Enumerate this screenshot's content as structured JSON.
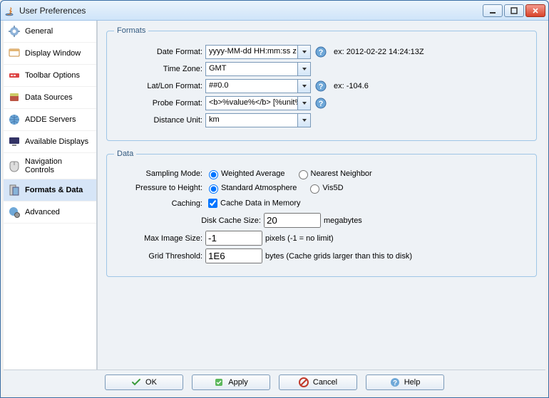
{
  "window": {
    "title": "User Preferences"
  },
  "sidebar": {
    "items": [
      {
        "label": "General",
        "icon": "gear-icon",
        "selected": false
      },
      {
        "label": "Display Window",
        "icon": "monitor-icon",
        "selected": false
      },
      {
        "label": "Toolbar Options",
        "icon": "toolbar-icon",
        "selected": false
      },
      {
        "label": "Data Sources",
        "icon": "datasources-icon",
        "selected": false
      },
      {
        "label": "ADDE Servers",
        "icon": "globe-icon",
        "selected": false
      },
      {
        "label": "Available Displays",
        "icon": "display-icon",
        "selected": false
      },
      {
        "label": "Navigation Controls",
        "icon": "mouse-icon",
        "selected": false
      },
      {
        "label": "Formats & Data",
        "icon": "formats-icon",
        "selected": true
      },
      {
        "label": "Advanced",
        "icon": "globe-gear-icon",
        "selected": false
      }
    ]
  },
  "formats": {
    "legend": "Formats",
    "date_format": {
      "label": "Date Format:",
      "value": "yyyy-MM-dd HH:mm:ss z",
      "hint": "ex:  2012-02-22 14:24:13Z"
    },
    "time_zone": {
      "label": "Time Zone:",
      "value": "GMT"
    },
    "latlon_format": {
      "label": "Lat/Lon Format:",
      "value": "##0.0",
      "hint": "ex: -104.6"
    },
    "probe_format": {
      "label": "Probe Format:",
      "value": "<b>%value%</b> [%unit%]"
    },
    "distance_unit": {
      "label": "Distance Unit:",
      "value": "km"
    }
  },
  "data": {
    "legend": "Data",
    "sampling_mode": {
      "label": "Sampling Mode:",
      "options": [
        {
          "label": "Weighted Average",
          "checked": true
        },
        {
          "label": "Nearest Neighbor",
          "checked": false
        }
      ]
    },
    "pressure_to_height": {
      "label": "Pressure to Height:",
      "options": [
        {
          "label": "Standard Atmosphere",
          "checked": true
        },
        {
          "label": "Vis5D",
          "checked": false
        }
      ]
    },
    "caching": {
      "label": "Caching:",
      "checkbox_label": "Cache Data in Memory",
      "checked": true
    },
    "disk_cache": {
      "label": "Disk Cache Size:",
      "value": "20",
      "suffix": "megabytes"
    },
    "max_image": {
      "label": "Max Image Size:",
      "value": "-1",
      "suffix": "pixels (-1 = no limit)"
    },
    "grid_threshold": {
      "label": "Grid Threshold:",
      "value": "1E6",
      "suffix": "bytes (Cache grids larger than this to disk)"
    }
  },
  "buttons": {
    "ok": "OK",
    "apply": "Apply",
    "cancel": "Cancel",
    "help": "Help"
  }
}
